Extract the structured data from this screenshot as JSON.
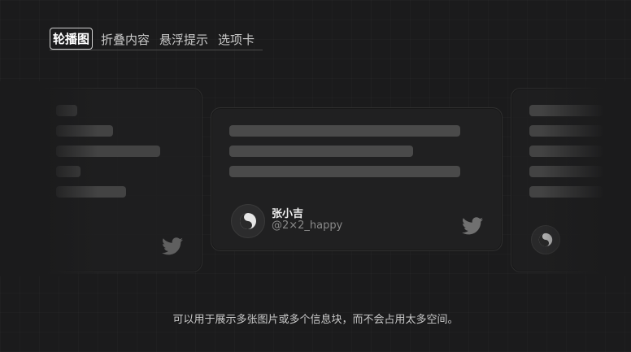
{
  "tabs": [
    {
      "label": "轮播图",
      "active": true
    },
    {
      "label": "折叠内容",
      "active": false
    },
    {
      "label": "悬浮提示",
      "active": false
    },
    {
      "label": "选项卡",
      "active": false
    }
  ],
  "carousel": {
    "center_card": {
      "user_name": "张小吉",
      "user_handle": "@2×2_happy",
      "avatar_icon": "yin-yang-icon",
      "brand_icon": "twitter-icon"
    }
  },
  "caption": "可以用于展示多张图片或多个信息块，而不会占用太多空间。",
  "colors": {
    "background": "#1b1b1c",
    "card": "#202021",
    "placeholder": "#4a4a4a"
  }
}
